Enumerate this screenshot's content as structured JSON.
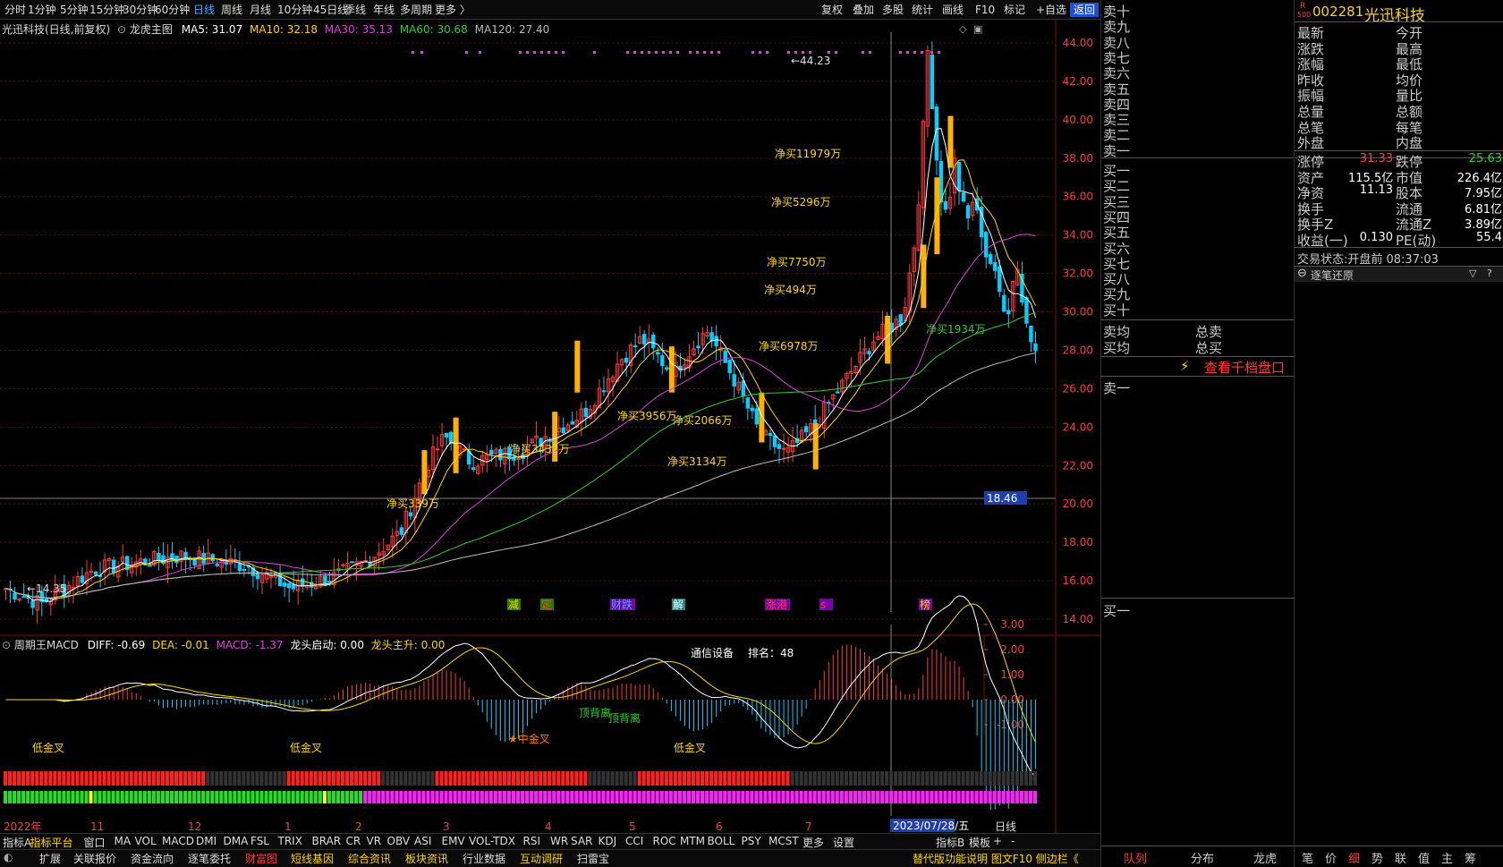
{
  "toolbar": {
    "tabs": [
      "分时",
      "1分钟",
      "5分钟",
      "15分钟",
      "30分钟",
      "60分钟",
      "日线",
      "周线",
      "月线",
      "10分钟",
      "45日线",
      "季线",
      "年线",
      "多周期",
      "更多"
    ],
    "right_tabs": [
      "复权",
      "叠加",
      "多股",
      "统计",
      "画线",
      "F10",
      "标记",
      "+自选",
      "返回"
    ],
    "active": "日线"
  },
  "chart_header": {
    "stock": "光迅科技(日线,前复权)",
    "main_indicator": "龙虎主图",
    "ma5": "MA5: 31.07",
    "ma10": "MA10: 32.18",
    "ma30": "MA30: 35.13",
    "ma60": "MA60: 30.68",
    "ma120": "MA120: 27.40"
  },
  "price_axis": [
    "44.00",
    "42.00",
    "40.00",
    "38.00",
    "36.00",
    "34.00",
    "32.00",
    "30.00",
    "28.00",
    "26.00",
    "24.00",
    "22.00",
    "20.00",
    "18.00",
    "16.00",
    "14.00"
  ],
  "crosshair_price": "18.46",
  "annotations": {
    "high": "44.23",
    "low": "14.35",
    "net_buys": [
      "净买339万",
      "净买3432万",
      "净买3956万",
      "净买2066万",
      "净买3134万",
      "净买6978万",
      "净买494万",
      "净买7750万",
      "净买5296万",
      "净买11979万",
      "净买1934万"
    ],
    "events": [
      "减",
      "定",
      "财跌",
      "解",
      "涨港",
      "s",
      "榜"
    ]
  },
  "macd_header": {
    "name": "周期王MACD",
    "diff": "DIFF: -0.69",
    "dea": "DEA: -0.01",
    "macd": "MACD: -1.37",
    "start": "龙头启动: 0.00",
    "up": "龙头主升: 0.00"
  },
  "macd_axis": [
    "3.00",
    "2.00",
    "1.00",
    "0.00",
    "-1.00"
  ],
  "macd_labels": {
    "sector": "通信设备",
    "rank": "排名：48",
    "top_div1": "顶背离",
    "top_div2": "顶背离",
    "low_cross1": "低金叉",
    "low_cross2": "低金叉",
    "low_cross3": "低金叉",
    "gold": "★中金叉"
  },
  "date_axis": [
    "2022年",
    "11",
    "12",
    "1",
    "2",
    "3",
    "4",
    "5",
    "6",
    "7"
  ],
  "date_cursor": "2023/07/28/五",
  "period_label": "日线",
  "bottom_tabs": [
    "指标A",
    "指标平台",
    "窗口",
    "MA",
    "VOL",
    "MACD",
    "DMI",
    "DMA",
    "FSL",
    "TRIX",
    "BRAR",
    "CR",
    "VR",
    "OBV",
    "ASI",
    "EMV",
    "VOL-TDX",
    "RSI",
    "WR",
    "SAR",
    "KDJ",
    "CCI",
    "ROC",
    "MTM",
    "BOLL",
    "PSY",
    "MCST",
    "更多",
    "设置"
  ],
  "bottom_right": [
    "指标B",
    "模板",
    "+",
    "-"
  ],
  "bottom_tabs2": [
    "扩展",
    "关联报价",
    "资金流向",
    "逐笔委托",
    "财富图",
    "短线基因",
    "综合资讯",
    "板块资讯",
    "行业数据",
    "互动调研",
    "扫雷宝"
  ],
  "bottom_right2": "替代版功能说明  图文F10  侧边栏《",
  "stock_code": "002281",
  "stock_name": "光迅科技",
  "orderbook_sell": [
    "卖十",
    "卖九",
    "卖八",
    "卖七",
    "卖六",
    "卖五",
    "卖四",
    "卖三",
    "卖二",
    "卖一"
  ],
  "orderbook_buy": [
    "买一",
    "买二",
    "买三",
    "买四",
    "买五",
    "买六",
    "买七",
    "买八",
    "买九",
    "买十"
  ],
  "avg": {
    "sell": "卖均",
    "buy": "买均",
    "total_sell": "总卖",
    "total_buy": "总买"
  },
  "ten_level": "查看千档盘口",
  "sell_one": "卖一",
  "buy_one": "买一",
  "quote_left": [
    "最新",
    "涨跌",
    "涨幅",
    "昨收",
    "振幅",
    "总量",
    "总笔",
    "外盘"
  ],
  "quote_right": [
    "今开",
    "最高",
    "最低",
    "均价",
    "量比",
    "总额",
    "每笔",
    "内盘"
  ],
  "limits": {
    "up_label": "涨停",
    "up": "31.33",
    "down_label": "跌停",
    "down": "25.63",
    "assets_label": "资产",
    "assets": "115.5亿",
    "mcap_label": "市值",
    "mcap": "226.4亿",
    "net_label": "净资",
    "net": "11.13",
    "shares_label": "股本",
    "shares": "7.95亿",
    "turn_label": "换手",
    "float_label": "流通",
    "float": "6.81亿",
    "turnz_label": "换手Z",
    "floatz_label": "流通Z",
    "floatz": "3.89亿",
    "eps_label": "收益(一)",
    "eps": "0.130",
    "pe_label": "PE(动)",
    "pe": "55.4"
  },
  "trade_status": "交易状态:开盘前 08:37:03",
  "tick_title": "逐笔还原",
  "right_bottom_tabs": [
    "队列",
    "分布",
    "龙虎"
  ],
  "right_bottom_tabs2": [
    "笔",
    "价",
    "细",
    "势",
    "联",
    "值",
    "主",
    "筹"
  ],
  "r_badge": "R",
  "r_badge_sub": "500"
}
